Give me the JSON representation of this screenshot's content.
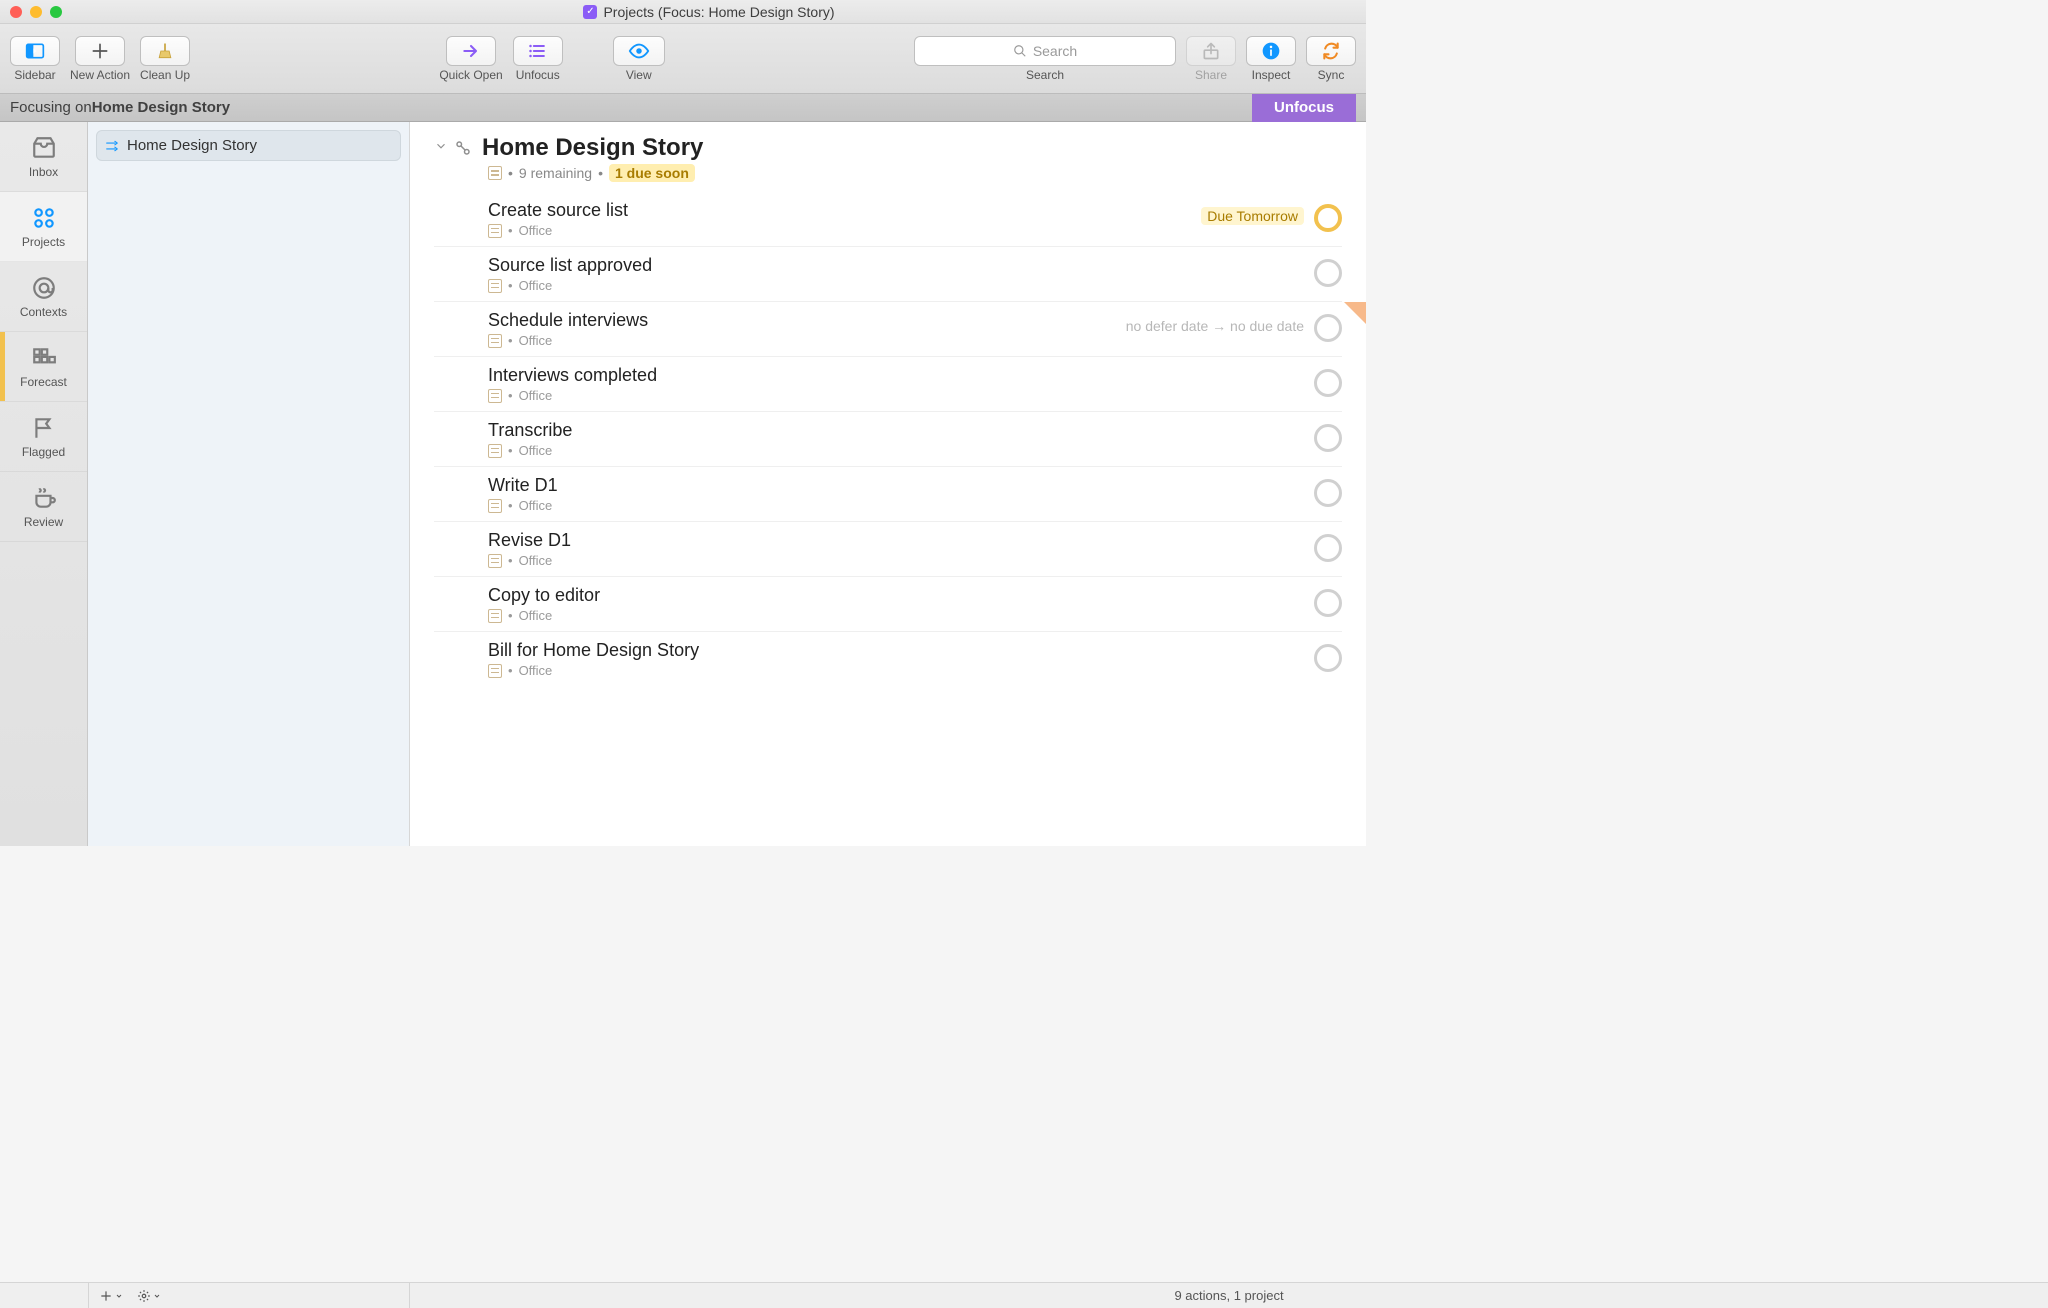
{
  "window": {
    "title": "Projects (Focus: Home Design Story)"
  },
  "toolbar": {
    "sidebar": "Sidebar",
    "newAction": "New Action",
    "cleanUp": "Clean Up",
    "quickOpen": "Quick Open",
    "unfocus": "Unfocus",
    "view": "View",
    "searchLabel": "Search",
    "searchPlaceholder": "Search",
    "share": "Share",
    "inspect": "Inspect",
    "sync": "Sync"
  },
  "focus": {
    "prefix": "Focusing on ",
    "project": "Home Design Story",
    "unfocusBtn": "Unfocus"
  },
  "rail": {
    "inbox": "Inbox",
    "projects": "Projects",
    "contexts": "Contexts",
    "forecast": "Forecast",
    "flagged": "Flagged",
    "review": "Review"
  },
  "projectList": {
    "item0": "Home Design Story"
  },
  "header": {
    "title": "Home Design Story",
    "remaining": "9 remaining",
    "dueSoon": "1 due soon"
  },
  "tasks": [
    {
      "title": "Create source list",
      "context": "Office",
      "due": "Due Tomorrow",
      "dueStatus": "soon",
      "flag": false
    },
    {
      "title": "Source list approved",
      "context": "Office"
    },
    {
      "title": "Schedule interviews",
      "context": "Office",
      "defer": "no defer date → no due date",
      "flag": true
    },
    {
      "title": "Interviews completed",
      "context": "Office"
    },
    {
      "title": "Transcribe",
      "context": "Office"
    },
    {
      "title": "Write D1",
      "context": "Office"
    },
    {
      "title": "Revise D1",
      "context": "Office"
    },
    {
      "title": "Copy to editor",
      "context": "Office"
    },
    {
      "title": "Bill for Home Design Story",
      "context": "Office"
    }
  ],
  "status": {
    "summary": "9 actions, 1 project"
  }
}
